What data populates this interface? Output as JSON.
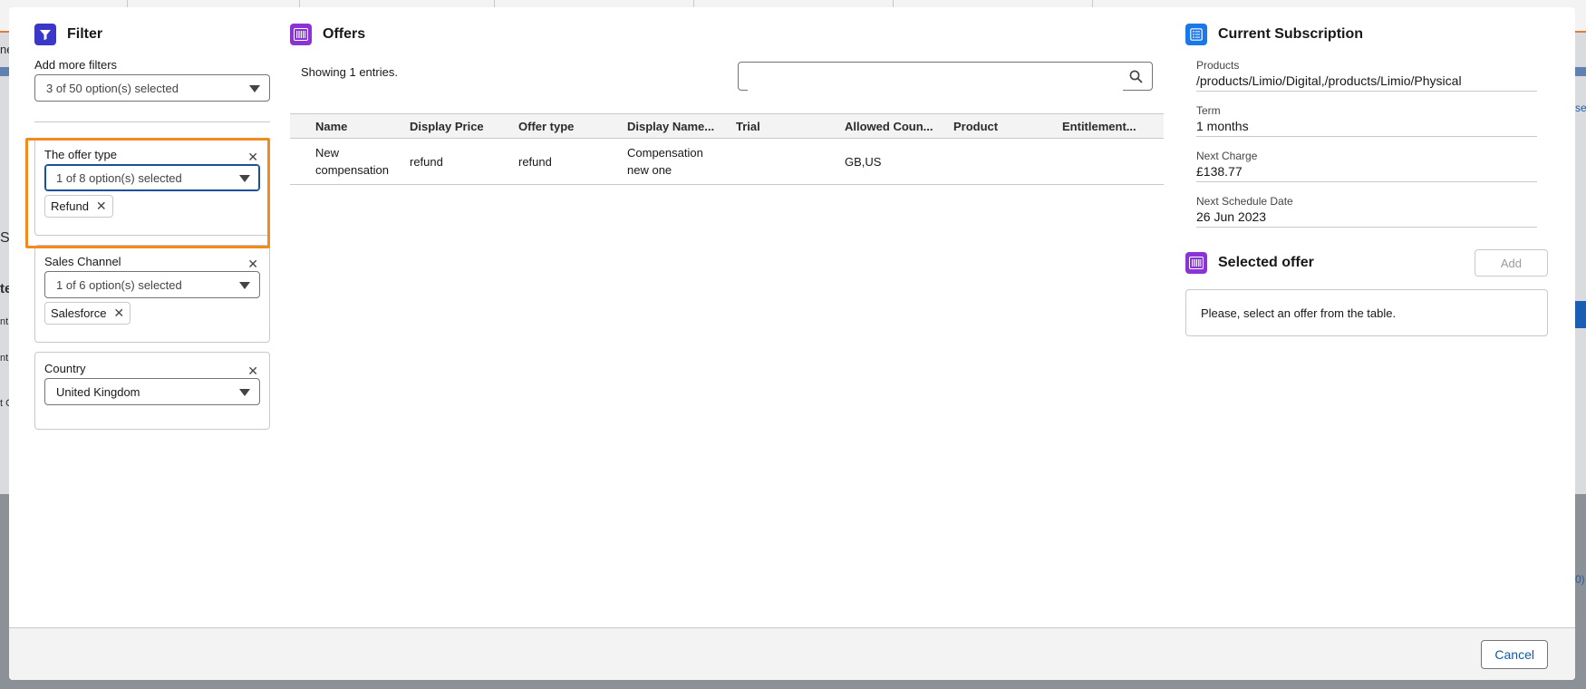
{
  "filter": {
    "title": "Filter",
    "add_more_label": "Add more filters",
    "add_more_value": "3 of 50 option(s) selected",
    "cards": [
      {
        "label": "The offer type",
        "value": "1 of 8 option(s) selected",
        "pill": "Refund"
      },
      {
        "label": "Sales Channel",
        "value": "1 of 6 option(s) selected",
        "pill": "Salesforce"
      },
      {
        "label": "Country",
        "value": "United Kingdom"
      }
    ]
  },
  "offers": {
    "title": "Offers",
    "showing": "Showing 1 entries.",
    "search_placeholder": "",
    "columns": [
      "Name",
      "Display Price",
      "Offer type",
      "Display Name...",
      "Trial",
      "Allowed Coun...",
      "Product",
      "Entitlement..."
    ],
    "rows": [
      {
        "name_line1": "New",
        "name_line2": "compensation",
        "display_price": "refund",
        "offer_type": "refund",
        "display_name_line1": "Compensation",
        "display_name_line2": "new one",
        "trial": "",
        "allowed_countries": "GB,US",
        "product": "",
        "entitlements": ""
      }
    ]
  },
  "subscription": {
    "title": "Current Subscription",
    "fields": [
      {
        "label": "Products",
        "value": "/products/Limio/Digital,/products/Limio/Physical"
      },
      {
        "label": "Term",
        "value": "1 months"
      },
      {
        "label": "Next Charge",
        "value": "£138.77"
      },
      {
        "label": "Next Schedule Date",
        "value": "26 Jun 2023"
      }
    ]
  },
  "selected_offer": {
    "title": "Selected offer",
    "add_label": "Add",
    "empty_message": "Please, select an offer from the table."
  },
  "footer": {
    "cancel_label": "Cancel"
  },
  "background_fragments": [
    "ne",
    "S",
    "te",
    "nt",
    "nt",
    "t C",
    "se",
    "0)"
  ],
  "colors": {
    "filter_icon": "#3a37c9",
    "offers_icon": "#8a33d6",
    "subscription_icon": "#1b78e8",
    "highlight": "#f08c1d",
    "link_blue": "#0b5cab"
  }
}
